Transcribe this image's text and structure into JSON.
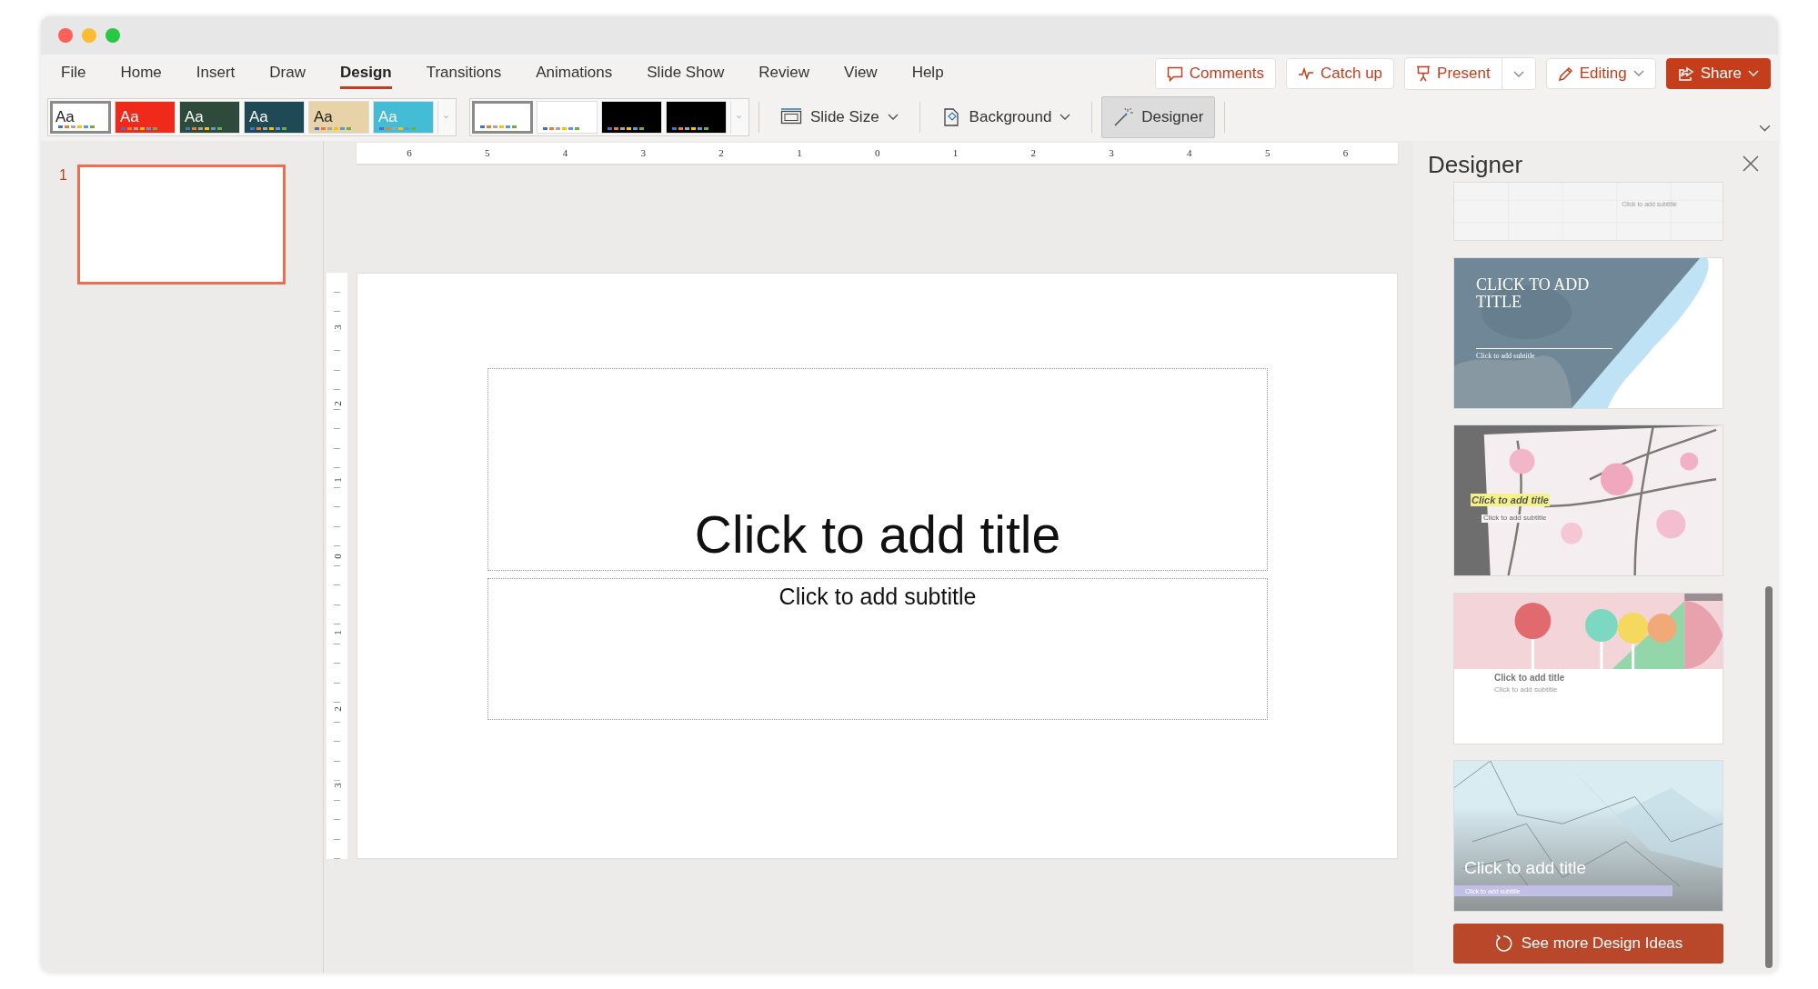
{
  "menu_tabs": [
    {
      "label": "File",
      "selected": false
    },
    {
      "label": "Home",
      "selected": false
    },
    {
      "label": "Insert",
      "selected": false
    },
    {
      "label": "Draw",
      "selected": false
    },
    {
      "label": "Design",
      "selected": true
    },
    {
      "label": "Transitions",
      "selected": false
    },
    {
      "label": "Animations",
      "selected": false
    },
    {
      "label": "Slide Show",
      "selected": false
    },
    {
      "label": "Review",
      "selected": false
    },
    {
      "label": "View",
      "selected": false
    },
    {
      "label": "Help",
      "selected": false
    }
  ],
  "header_buttons": [
    {
      "kind": "comments",
      "label": "Comments"
    },
    {
      "kind": "catch_up",
      "label": "Catch up"
    },
    {
      "kind": "present",
      "label": "Present"
    },
    {
      "kind": "editing",
      "label": "Editing"
    },
    {
      "kind": "share",
      "label": "Share"
    }
  ],
  "ribbon": {
    "themes": [
      {
        "label": "Aa",
        "selected": true,
        "color": "#ffffff"
      },
      {
        "label": "Aa",
        "selected": false,
        "color": "#f02a1a"
      },
      {
        "label": "Aa",
        "selected": false,
        "color": "#2e4a3a"
      },
      {
        "label": "Aa",
        "selected": false,
        "color": "#1f4a55"
      },
      {
        "label": "Aa",
        "selected": false,
        "color": "#e8d2a8"
      },
      {
        "label": "Aa",
        "selected": false,
        "color": "#45bcd6"
      }
    ],
    "variants": [
      {
        "selected": true,
        "color": "#ffffff"
      },
      {
        "selected": false,
        "color": "#ffffff"
      },
      {
        "selected": false,
        "color": "#000000"
      },
      {
        "selected": false,
        "color": "#000000"
      }
    ],
    "slide_size": "Slide Size",
    "background": "Background",
    "designer": {
      "label": "Designer",
      "selected": true
    }
  },
  "slides_panel": {
    "slides": [
      {
        "number": "1",
        "selected": true
      }
    ]
  },
  "ruler": {
    "horizontal": [
      "6",
      "5",
      "4",
      "3",
      "2",
      "1",
      "0",
      "1",
      "2",
      "3",
      "4",
      "5",
      "6"
    ],
    "vertical": [
      "3",
      "2",
      "1",
      "0",
      "1",
      "2",
      "3"
    ]
  },
  "slide": {
    "title_placeholder": "Click to add title",
    "subtitle_placeholder": "Click to add subtitle"
  },
  "designer": {
    "title": "Designer",
    "ideas": [
      {
        "kind": "plain",
        "subtitle": "Click to add subtitle"
      },
      {
        "kind": "watercolor",
        "title": "CLICK TO ADD TITLE",
        "subtitle": "Click to add subtitle"
      },
      {
        "kind": "blossom",
        "title": "Click to add title",
        "subtitle": "Click to add subtitle"
      },
      {
        "kind": "lollipops",
        "title": "Click to add title",
        "subtitle": "Click to add subtitle"
      },
      {
        "kind": "network",
        "title": "Click to add title",
        "subtitle": "Click to add subtitle"
      }
    ],
    "more_button": "See more Design Ideas"
  }
}
